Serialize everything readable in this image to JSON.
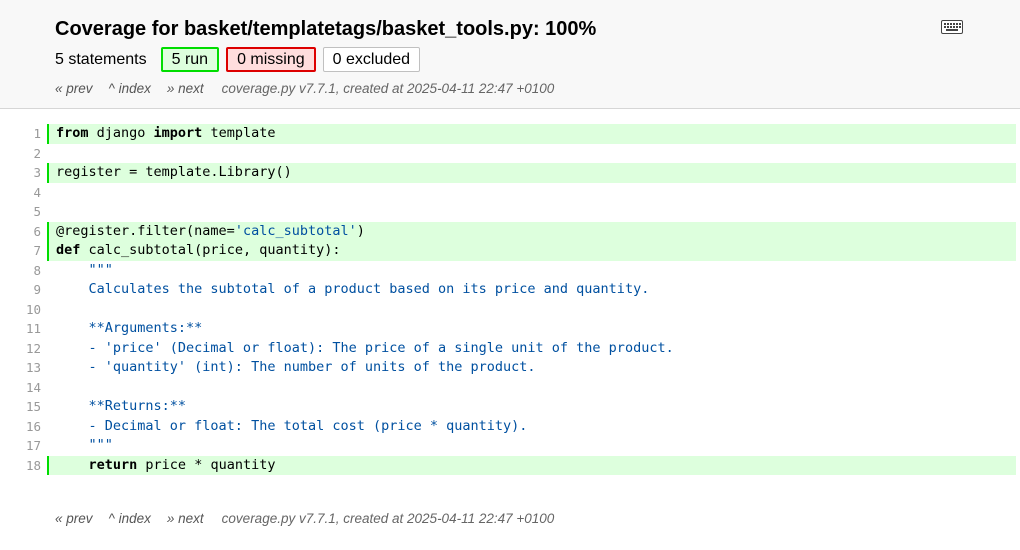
{
  "header": {
    "title_prefix": "Coverage for ",
    "title_file": "basket/templatetags/basket_tools.py",
    "title_suffix": ": 100%",
    "statements_label": "5 statements",
    "run_label": "5 run",
    "missing_label": "0 missing",
    "excluded_label": "0 excluded"
  },
  "nav": {
    "prev": "« prev",
    "index": "^ index",
    "next": "» next",
    "created": "coverage.py v7.7.1, created at 2025-04-11 22:47 +0100"
  },
  "colors": {
    "run_bg": "#ddffdd",
    "run_border": "#00dd00",
    "missing_bg": "#ffdddd",
    "missing_border": "#dd0000",
    "string": "#0050a0"
  },
  "icons": {
    "keyboard": "keyboard-icon"
  },
  "source_lines": [
    {
      "n": "1",
      "run": true
    },
    {
      "n": "2",
      "run": false
    },
    {
      "n": "3",
      "run": true
    },
    {
      "n": "4",
      "run": false
    },
    {
      "n": "5",
      "run": false
    },
    {
      "n": "6",
      "run": true
    },
    {
      "n": "7",
      "run": true
    },
    {
      "n": "8",
      "run": false
    },
    {
      "n": "9",
      "run": false
    },
    {
      "n": "10",
      "run": false
    },
    {
      "n": "11",
      "run": false
    },
    {
      "n": "12",
      "run": false
    },
    {
      "n": "13",
      "run": false
    },
    {
      "n": "14",
      "run": false
    },
    {
      "n": "15",
      "run": false
    },
    {
      "n": "16",
      "run": false
    },
    {
      "n": "17",
      "run": false
    },
    {
      "n": "18",
      "run": true
    }
  ],
  "code": {
    "l1_kw1": "from",
    "l1_mid": " django ",
    "l1_kw2": "import",
    "l1_end": " template",
    "l3": "register = template.Library()",
    "l6_a": "@register.filter(name=",
    "l6_str": "'calc_subtotal'",
    "l6_b": ")",
    "l7_kw": "def",
    "l7_rest": " calc_subtotal(price, quantity):",
    "l8": "    \"\"\"",
    "l9": "    Calculates the subtotal of a product based on its price and quantity.",
    "l11": "    **Arguments:**",
    "l12": "    - 'price' (Decimal or float): The price of a single unit of the product.",
    "l13": "    - 'quantity' (int): The number of units of the product.",
    "l15": "    **Returns:**",
    "l16": "    - Decimal or float: The total cost (price * quantity).",
    "l17": "    \"\"\"",
    "l18_indent": "    ",
    "l18_kw": "return",
    "l18_rest": " price * quantity"
  }
}
